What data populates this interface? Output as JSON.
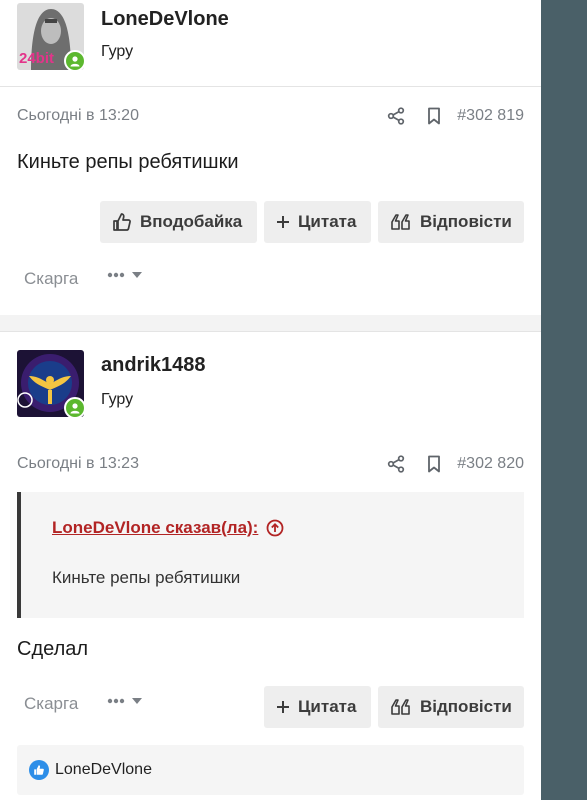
{
  "posts": [
    {
      "author": "LoneDeVlone",
      "avatar_text": "24bit",
      "rank": "Гуру",
      "date": "Сьогодні в 13:20",
      "post_number": "#302 819",
      "message": "Киньте репы ребятишки",
      "actions": {
        "like": "Вподобайка",
        "quote": "Цитата",
        "reply": "Відповісти",
        "report": "Скарга"
      }
    },
    {
      "author": "andrik1488",
      "rank": "Гуру",
      "date": "Сьогодні в 13:23",
      "post_number": "#302 820",
      "quote": {
        "author": "LoneDeVlone сказав(ла):",
        "text": "Киньте репы ребятишки"
      },
      "message": "Сделал",
      "actions": {
        "quote": "Цитата",
        "reply": "Відповісти",
        "report": "Скарга"
      },
      "reactions": {
        "user": "LoneDeVlone"
      }
    }
  ],
  "icons": [
    "share-icon",
    "bookmark-icon",
    "thumbs-up-icon",
    "plus-icon",
    "quote-icon",
    "ellipsis-icon",
    "caret-down-icon",
    "arrow-up-circle-icon",
    "online-user-icon"
  ],
  "colors": {
    "side_panel": "#4a6068",
    "online": "#5cb82f",
    "quote_link": "#b22424",
    "like_badge": "#2d8ee8"
  }
}
